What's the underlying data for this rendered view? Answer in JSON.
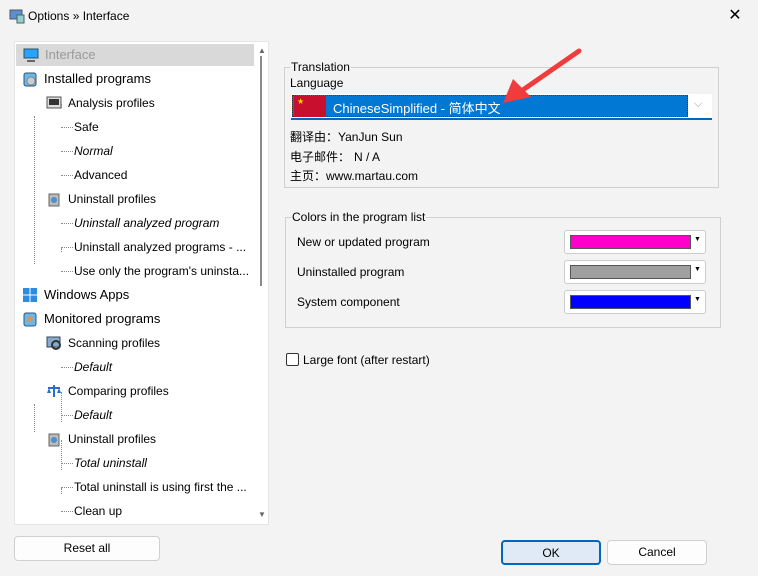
{
  "window": {
    "title": "Options » Interface"
  },
  "tree": [
    {
      "label": "Interface",
      "level": 0,
      "icon": "monitor-icon",
      "selected": true
    },
    {
      "label": "Installed programs",
      "level": 0,
      "icon": "installed-programs-icon"
    },
    {
      "label": "Analysis profiles",
      "level": 1,
      "icon": "analysis-icon"
    },
    {
      "label": "Safe",
      "level": 2
    },
    {
      "label": "Normal",
      "level": 2,
      "italic": true
    },
    {
      "label": "Advanced",
      "level": 2
    },
    {
      "label": "Uninstall profiles",
      "level": 1,
      "icon": "trash-icon"
    },
    {
      "label": "Uninstall analyzed program",
      "level": 2,
      "italic": true
    },
    {
      "label": "Uninstall analyzed programs - ...",
      "level": 2
    },
    {
      "label": "Use only the program's uninsta...",
      "level": 2
    },
    {
      "label": "Windows Apps",
      "level": 0,
      "icon": "windows-icon"
    },
    {
      "label": "Monitored programs",
      "level": 0,
      "icon": "monitored-icon"
    },
    {
      "label": "Scanning profiles",
      "level": 1,
      "icon": "scan-icon"
    },
    {
      "label": "Default",
      "level": 2,
      "italic": true
    },
    {
      "label": "Comparing profiles",
      "level": 1,
      "icon": "scales-icon"
    },
    {
      "label": "Default",
      "level": 2,
      "italic": true
    },
    {
      "label": "Uninstall profiles",
      "level": 1,
      "icon": "trash-icon"
    },
    {
      "label": "Total uninstall",
      "level": 2,
      "italic": true
    },
    {
      "label": "Total uninstall is using first the ...",
      "level": 2
    },
    {
      "label": "Clean up",
      "level": 2
    }
  ],
  "translation": {
    "group_label": "Translation",
    "language_label": "Language",
    "language_value": "ChineseSimplified - 简体中文",
    "translator_label": "翻译由：",
    "translator": "YanJun Sun",
    "email_label": "电子邮件：",
    "email": "N / A",
    "homepage_label": "主页：",
    "homepage": "www.martau.com"
  },
  "colors": {
    "group_label": "Colors in the program list",
    "rows": [
      {
        "label": "New or updated program",
        "color": "#ff00cc"
      },
      {
        "label": "Uninstalled program",
        "color": "#a0a0a0"
      },
      {
        "label": "System component",
        "color": "#0000ff"
      }
    ]
  },
  "large_font": {
    "label": "Large font (after restart)",
    "checked": false
  },
  "buttons": {
    "reset": "Reset all",
    "ok": "OK",
    "cancel": "Cancel"
  }
}
